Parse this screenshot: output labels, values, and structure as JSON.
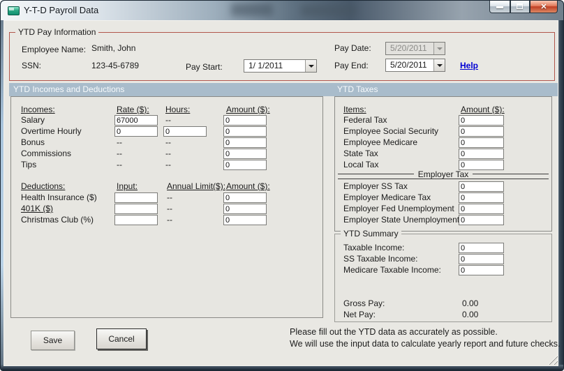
{
  "window": {
    "title": "Y-T-D Payroll Data"
  },
  "icons": {
    "app_icon": "teal-form",
    "minimize_icon": "bar",
    "maximize_icon": "square",
    "close_icon": "✕",
    "dropdown_arrow_icon": "▼",
    "resize_grip_icon": "◢"
  },
  "pay_info": {
    "legend": "YTD Pay Information",
    "employee_name_label": "Employee Name:",
    "employee_name": "Smith, John",
    "ssn_label": "SSN:",
    "ssn": "123-45-6789",
    "pay_start_label": "Pay Start:",
    "pay_start_value": "1/ 1/2011",
    "pay_date_label": "Pay Date:",
    "pay_date_value": "5/20/2011",
    "pay_end_label": "Pay End:",
    "pay_end_value": "5/20/2011",
    "help_label": "Help"
  },
  "incomes_section": {
    "header": "YTD Incomes and Deductions",
    "incomes": {
      "col_item": "Incomes:",
      "col_rate": "Rate ($):",
      "col_hours": "Hours:",
      "col_amount": "Amount ($):",
      "rows": [
        {
          "label": "Salary",
          "rate": "67000",
          "hours": "--",
          "amount": "0"
        },
        {
          "label": "Overtime Hourly",
          "rate": "0",
          "hours": "0",
          "amount": "0"
        },
        {
          "label": "Bonus",
          "rate": "--",
          "hours": "--",
          "amount": "0"
        },
        {
          "label": "Commissions",
          "rate": "--",
          "hours": "--",
          "amount": "0"
        },
        {
          "label": "Tips",
          "rate": "--",
          "hours": "--",
          "amount": "0"
        }
      ]
    },
    "deductions": {
      "col_item": "Deductions:",
      "col_input": "Input:",
      "col_limit": "Annual Limit($):",
      "col_amount": "Amount ($):",
      "rows": [
        {
          "label": "Health Insurance  ($)",
          "input": "",
          "limit": "--",
          "amount": "0"
        },
        {
          "label": "401K  ($)",
          "input": "",
          "limit": "--",
          "amount": "0"
        },
        {
          "label": "Christmas Club  (%)",
          "input": "",
          "limit": "--",
          "amount": "0"
        }
      ]
    }
  },
  "taxes_section": {
    "header": "YTD Taxes",
    "col_item": "Items:",
    "col_amount": "Amount ($):",
    "employee_rows": [
      {
        "label": "Federal Tax",
        "amount": "0"
      },
      {
        "label": "Employee Social Security",
        "amount": "0"
      },
      {
        "label": "Employee Medicare",
        "amount": "0"
      },
      {
        "label": "State Tax",
        "amount": "0"
      },
      {
        "label": "Local Tax",
        "amount": "0"
      }
    ],
    "divider_label": "Employer Tax",
    "employer_rows": [
      {
        "label": "Employer SS Tax",
        "amount": "0"
      },
      {
        "label": "Employer Medicare Tax",
        "amount": "0"
      },
      {
        "label": "Employer Fed Unemployment",
        "amount": "0"
      },
      {
        "label": "Employer State Unemployment",
        "amount": "0"
      }
    ]
  },
  "summary": {
    "legend": "YTD Summary",
    "rows": [
      {
        "label": "Taxable Income:",
        "amount": "0"
      },
      {
        "label": "SS Taxable Income:",
        "amount": "0"
      },
      {
        "label": "Medicare Taxable Income:",
        "amount": "0"
      }
    ],
    "gross_pay_label": "Gross Pay:",
    "gross_pay": "0.00",
    "net_pay_label": "Net Pay:",
    "net_pay": "0.00"
  },
  "footer": {
    "save_label": "Save",
    "cancel_label": "Cancel",
    "note_line1": "Please fill out the YTD data as accurately as possible.",
    "note_line2": "We will use the input data to calculate yearly report and future checks."
  },
  "colors": {
    "band_bg": "#a9bccb",
    "pay_info_border": "#b2564c",
    "close_button_red": "#bf3f24",
    "help_link_blue": "#0000d4"
  }
}
